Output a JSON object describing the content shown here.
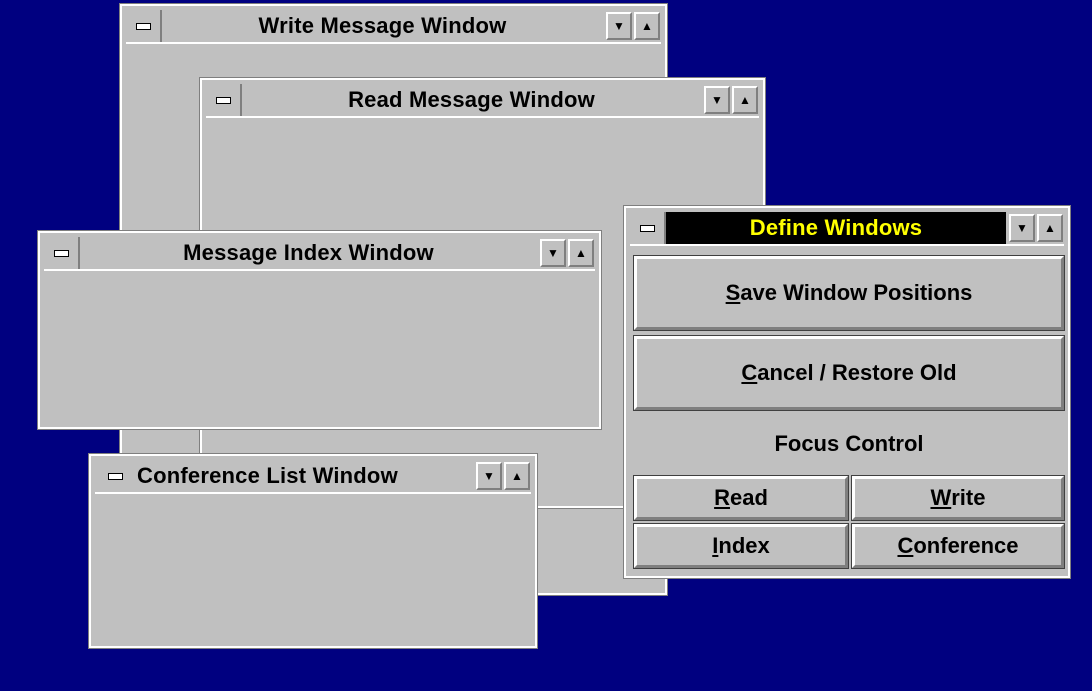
{
  "windows": {
    "write": {
      "title": "Write Message Window"
    },
    "read": {
      "title": "Read Message Window"
    },
    "index": {
      "title": "Message Index Window"
    },
    "conference": {
      "title": "Conference List Window"
    }
  },
  "define": {
    "title": "Define Windows",
    "save": {
      "mnemonic": "S",
      "rest": "ave Window Positions"
    },
    "cancel": {
      "mnemonic": "C",
      "rest": "ancel / Restore Old"
    },
    "focus_label": "Focus Control",
    "read": {
      "mnemonic": "R",
      "rest": "ead"
    },
    "write": {
      "mnemonic": "W",
      "rest": "rite"
    },
    "index": {
      "mnemonic": "I",
      "rest": "ndex"
    },
    "conference": {
      "mnemonic": "C",
      "rest": "onference"
    }
  },
  "icons": {
    "minimize": "▼",
    "maximize": "▲"
  },
  "colors": {
    "desktop": "#000080",
    "window": "#c0c0c0",
    "active_title_bg": "#000000",
    "active_title_text": "#ffff00"
  }
}
